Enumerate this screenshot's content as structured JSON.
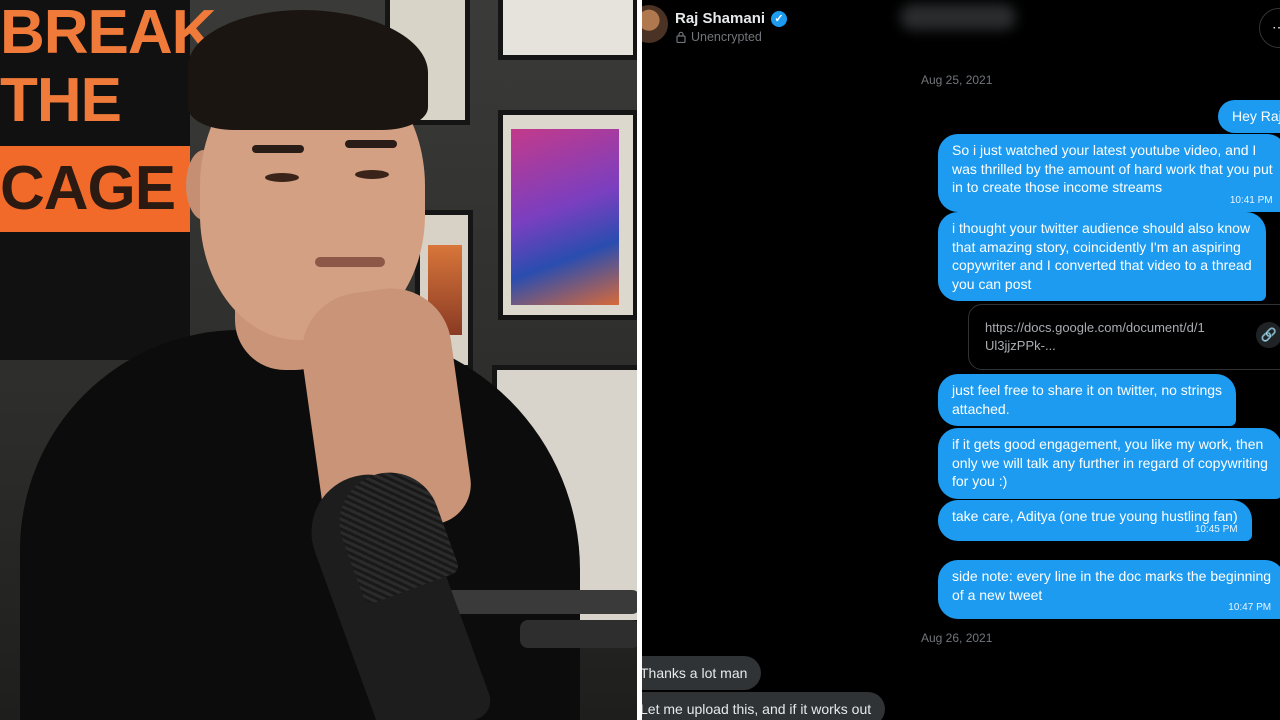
{
  "video": {
    "poster": {
      "line1": "BREAK",
      "line2": "THE",
      "line3": "CAGE"
    }
  },
  "chat": {
    "header": {
      "name": "Raj Shamani",
      "status": "Unencrypted"
    },
    "date_1": "Aug 25, 2021",
    "date_2": "Aug 26, 2021",
    "outgoing": [
      {
        "lines": [
          "Hey Raj"
        ]
      },
      {
        "lines": [
          "So i just watched your latest youtube video, and I",
          "was thrilled by the amount of hard work that you put",
          "in to create those income streams"
        ],
        "time": "10:41 PM"
      },
      {
        "lines": [
          "i thought your twitter audience should also know",
          "that amazing story, coincidently I'm an aspiring",
          "copywriter and I converted that video to a thread",
          "you can post"
        ]
      },
      {
        "lines": [
          "just feel free to share it on twitter, no strings",
          "attached."
        ]
      },
      {
        "lines": [
          "if it gets good engagement, you like my work, then",
          "only we will talk any further in regard of copywriting",
          "for you :)"
        ]
      },
      {
        "lines": [
          "take care, Aditya (one true young hustling fan)"
        ],
        "time": "10:45 PM"
      },
      {
        "lines": [
          "side note: every line in the doc marks the beginning",
          "of a new tweet"
        ],
        "time": "10:47 PM"
      }
    ],
    "link": {
      "line1": "https://docs.google.com/document/d/1",
      "line2": "Ul3jjzPPk-..."
    },
    "incoming": [
      {
        "text": "Thanks a lot man"
      },
      {
        "text": "Let me upload this, and if it works out"
      }
    ]
  }
}
